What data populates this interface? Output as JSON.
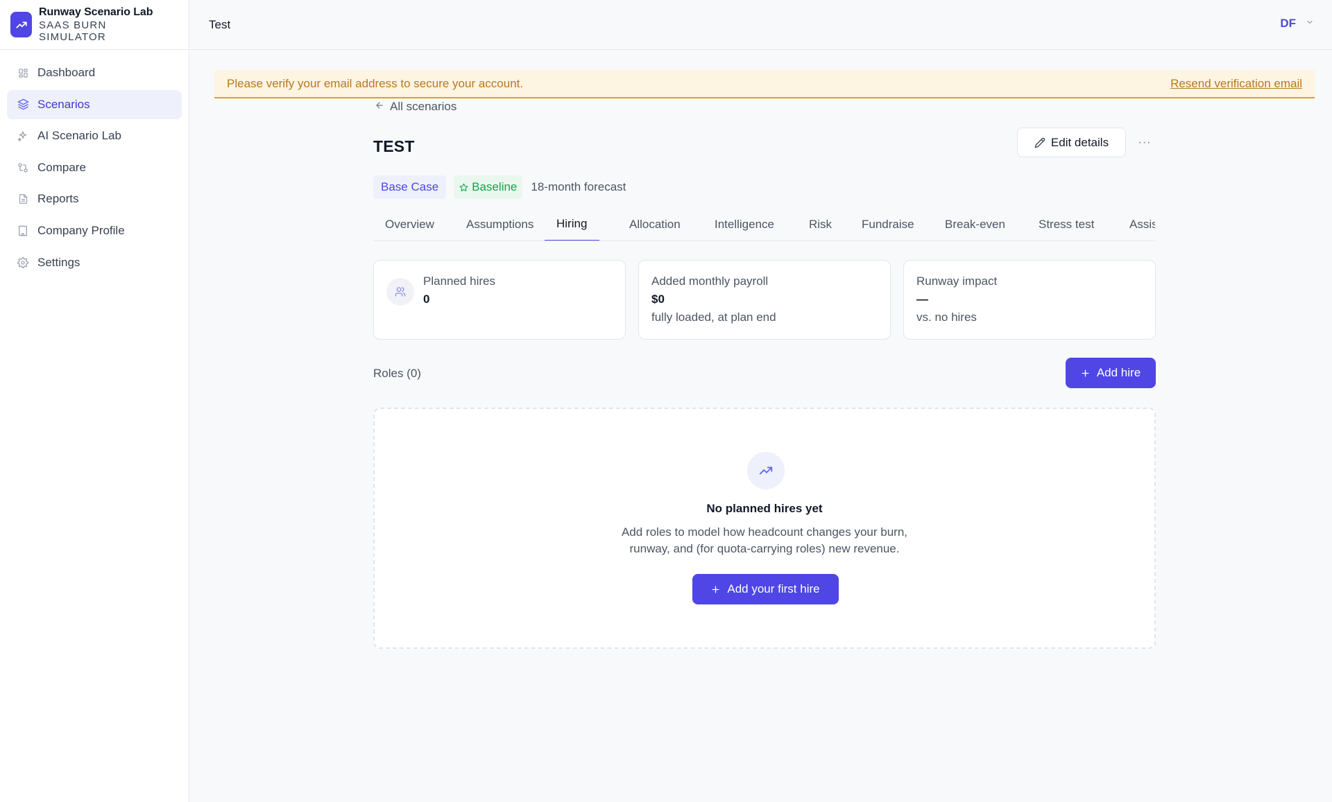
{
  "app": {
    "title": "Runway Scenario Lab",
    "subtitle_line1": "SAAS BURN",
    "subtitle_line2": "SIMULATOR"
  },
  "sidebar": {
    "items": [
      {
        "label": "Dashboard",
        "icon": "dashboard-grid-icon"
      },
      {
        "label": "Scenarios",
        "icon": "layers-icon",
        "active": true
      },
      {
        "label": "AI Scenario Lab",
        "icon": "sparkles-icon"
      },
      {
        "label": "Compare",
        "icon": "compare-arrows-icon"
      },
      {
        "label": "Reports",
        "icon": "document-icon"
      },
      {
        "label": "Company Profile",
        "icon": "building-icon"
      },
      {
        "label": "Settings",
        "icon": "gear-icon"
      }
    ]
  },
  "topbar": {
    "title": "Test",
    "user_initials": "DF"
  },
  "banner": {
    "text": "Please verify your email address to secure your account.",
    "link": "Resend verification email"
  },
  "scenario": {
    "back_label": "All scenarios",
    "title": "TEST",
    "edit_label": "Edit details",
    "more_label": "···",
    "case_badge": "Base Case",
    "baseline_badge": "Baseline",
    "forecast": "18-month forecast"
  },
  "tabs": [
    {
      "label": "Overview"
    },
    {
      "label": "Assumptions"
    },
    {
      "label": "Hiring",
      "active": true
    },
    {
      "label": "Allocation"
    },
    {
      "label": "Intelligence"
    },
    {
      "label": "Risk"
    },
    {
      "label": "Fundraise"
    },
    {
      "label": "Break-even"
    },
    {
      "label": "Stress test"
    },
    {
      "label": "Assistant"
    }
  ],
  "stats": [
    {
      "label": "Planned hires",
      "value": "0",
      "note": ""
    },
    {
      "label": "Added monthly payroll",
      "value": "$0",
      "note": "fully loaded, at plan end"
    },
    {
      "label": "Runway impact",
      "value": "—",
      "note": "vs. no hires"
    }
  ],
  "roles": {
    "label": "Roles (0)",
    "add_label": "Add hire"
  },
  "empty_state": {
    "title": "No planned hires yet",
    "desc_line1": "Add roles to model how headcount changes your burn,",
    "desc_line2": "runway, and (for quota-carrying roles) new revenue.",
    "button": "Add your first hire"
  },
  "colors": {
    "accent": "#4f46e5",
    "banner_bg": "#fdf4e2",
    "banner_text": "#b7791f",
    "baseline_green": "#16a34a"
  }
}
